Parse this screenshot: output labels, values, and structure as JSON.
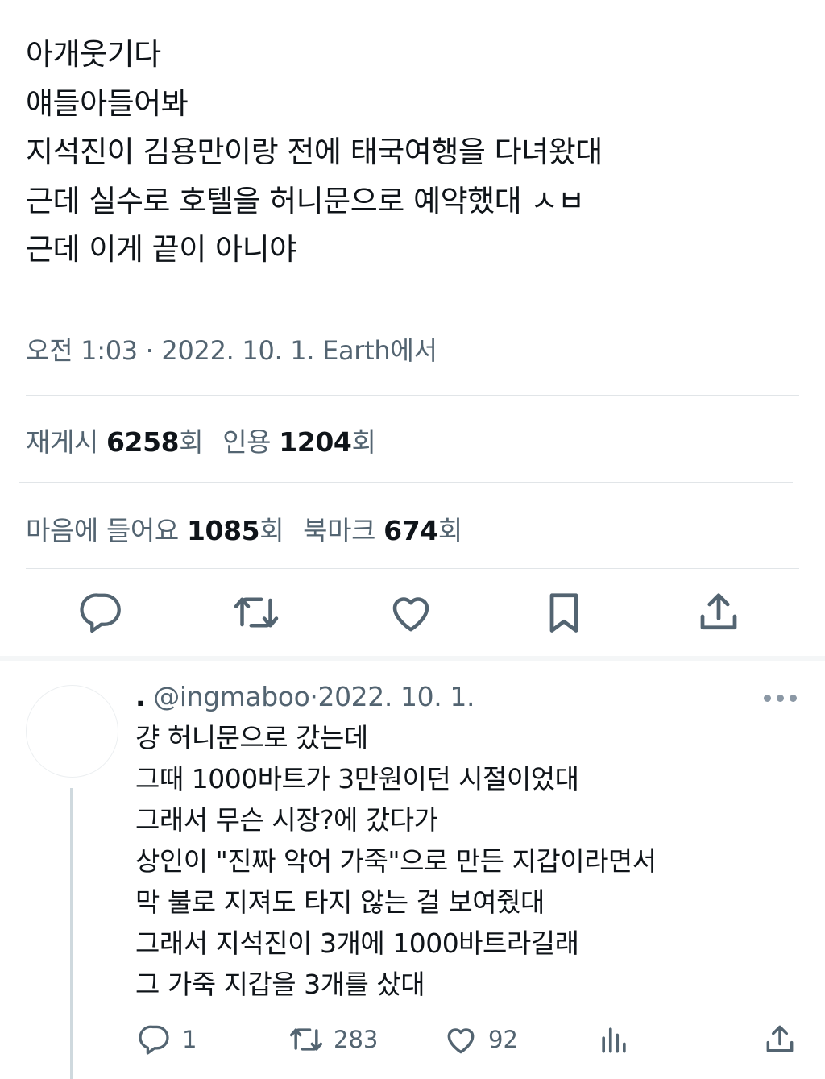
{
  "tweet": {
    "lines": [
      "아개웃기다",
      "얘들아들어봐",
      "지석진이 김용만이랑 전에 태국여행을 다녀왔대",
      "근데 실수로 호텔을 허니문으로 예약했대 ㅅㅂ",
      "근데 이게 끝이 아니야"
    ],
    "meta": "오전 1:03 · 2022. 10. 1. Earth에서"
  },
  "stats": {
    "retweets_label": "재게시",
    "retweets_count": "6258",
    "retweets_unit": "회",
    "quotes_label": "인용",
    "quotes_count": "1204",
    "quotes_unit": "회",
    "likes_label": "마음에 들어요",
    "likes_count": "1085",
    "likes_unit": "회",
    "bookmarks_label": "북마크",
    "bookmarks_count": "674",
    "bookmarks_unit": "회"
  },
  "actions": {
    "icons": [
      "reply-icon",
      "retweet-icon",
      "like-icon",
      "bookmark-icon",
      "share-icon"
    ],
    "color": "#536471"
  },
  "reply": {
    "dot": ".",
    "handle": "@ingmaboo",
    "separator": "·",
    "date": "2022. 10. 1.",
    "lines": [
      "걍 허니문으로 갔는데",
      "그때 1000바트가 3만원이던 시절이었대",
      "그래서 무슨 시장?에 갔다가",
      "상인이 \"진짜 악어 가죽\"으로 만든 지갑이라면서",
      "막 불로 지져도 타지 않는 걸 보여줬대",
      "그래서 지석진이 3개에 1000바트라길래",
      "그 가죽 지갑을 3개를 샀대"
    ],
    "reply_count": "1",
    "retweet_count": "283",
    "like_count": "92"
  }
}
